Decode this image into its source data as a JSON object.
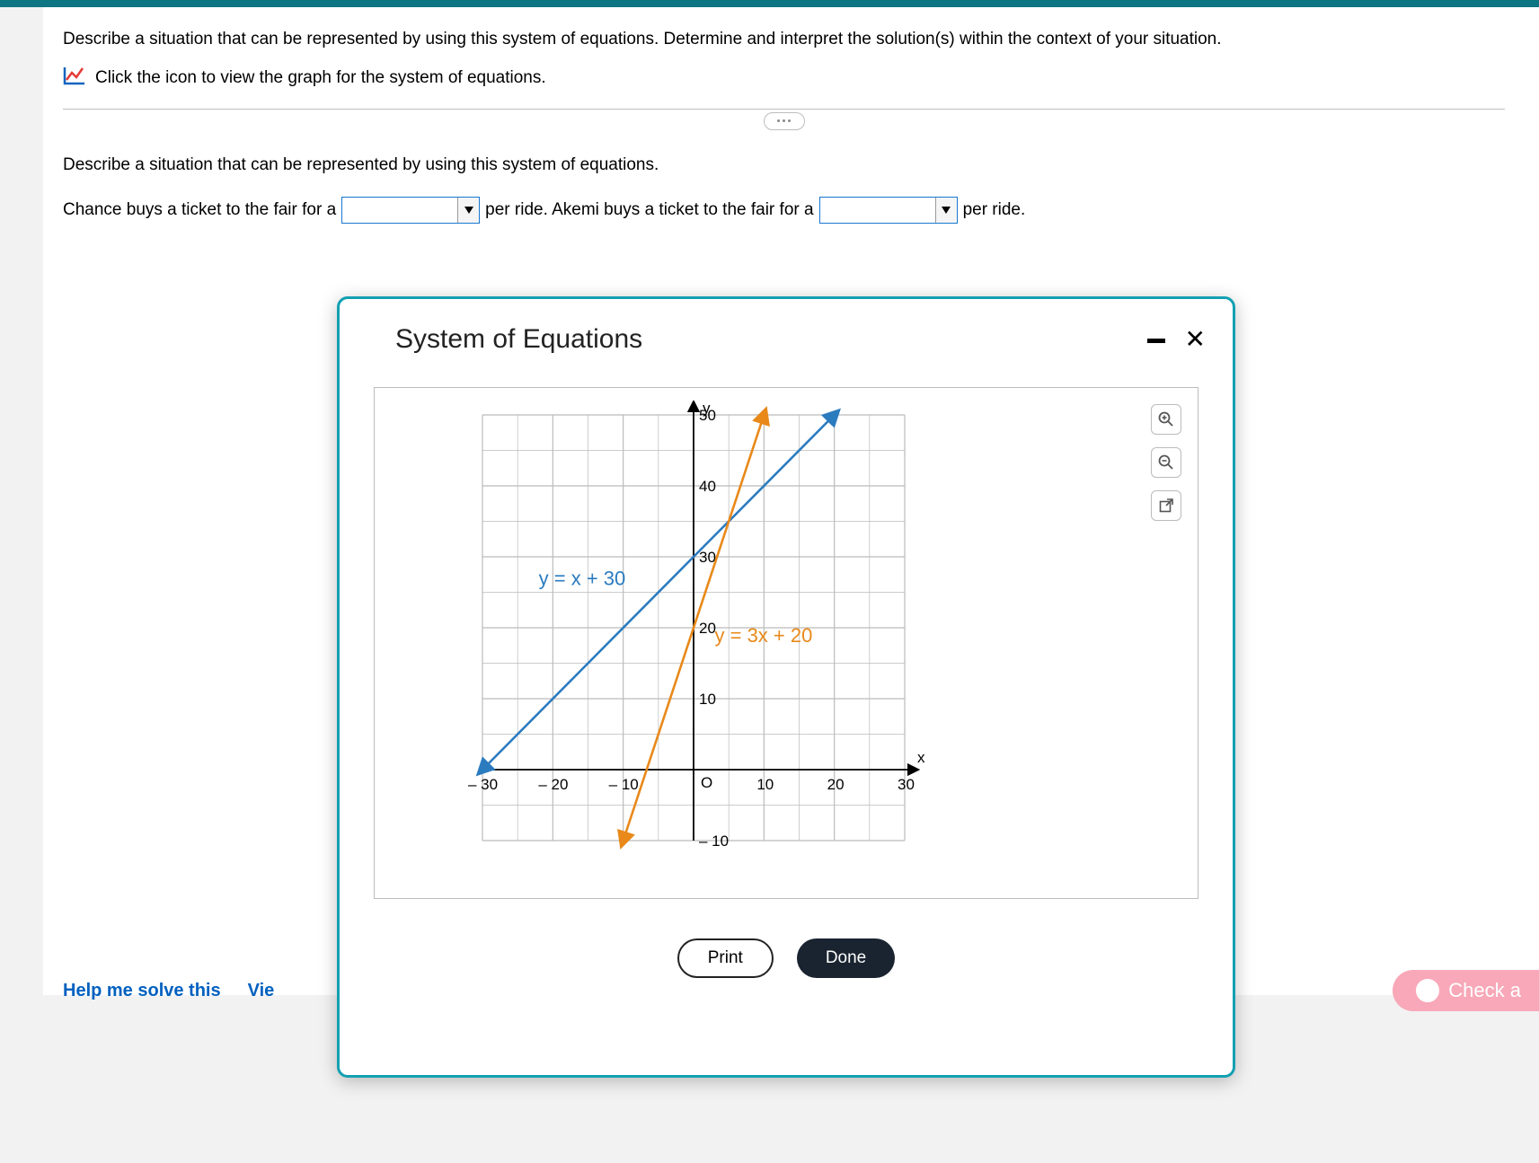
{
  "question": {
    "prompt_main": "Describe a situation that can be represented by using this system of equations. Determine and interpret the solution(s) within the context of your situation.",
    "icon_hint": "Click the icon to view the graph for the system of equations.",
    "prompt_sub": "Describe a situation that can be represented by using this system of equations.",
    "sentence": {
      "p1": "Chance buys a ticket to the fair for a",
      "p2": "per ride. Akemi buys a ticket to the fair for a",
      "p3": "per ride."
    }
  },
  "modal": {
    "title": "System of Equations",
    "print": "Print",
    "done": "Done"
  },
  "footer": {
    "help": "Help me solve this",
    "view": "Vie",
    "check": "Check a"
  },
  "chart_data": {
    "type": "line",
    "title": "System of Equations",
    "xlabel": "x",
    "ylabel": "y",
    "xlim": [
      -30,
      30
    ],
    "ylim": [
      -10,
      50
    ],
    "xticks": [
      -30,
      -20,
      -10,
      0,
      10,
      20,
      30
    ],
    "yticks": [
      -10,
      10,
      20,
      30,
      40,
      50
    ],
    "grid_step": 5,
    "series": [
      {
        "name": "y = x + 30",
        "color": "#2b7bbf",
        "points": [
          [
            -30,
            0
          ],
          [
            20,
            50
          ]
        ]
      },
      {
        "name": "y = 3x + 20",
        "color": "#e8891a",
        "points": [
          [
            -10,
            -10
          ],
          [
            10,
            50
          ]
        ]
      }
    ],
    "intersection": {
      "x": 5,
      "y": 35
    }
  }
}
